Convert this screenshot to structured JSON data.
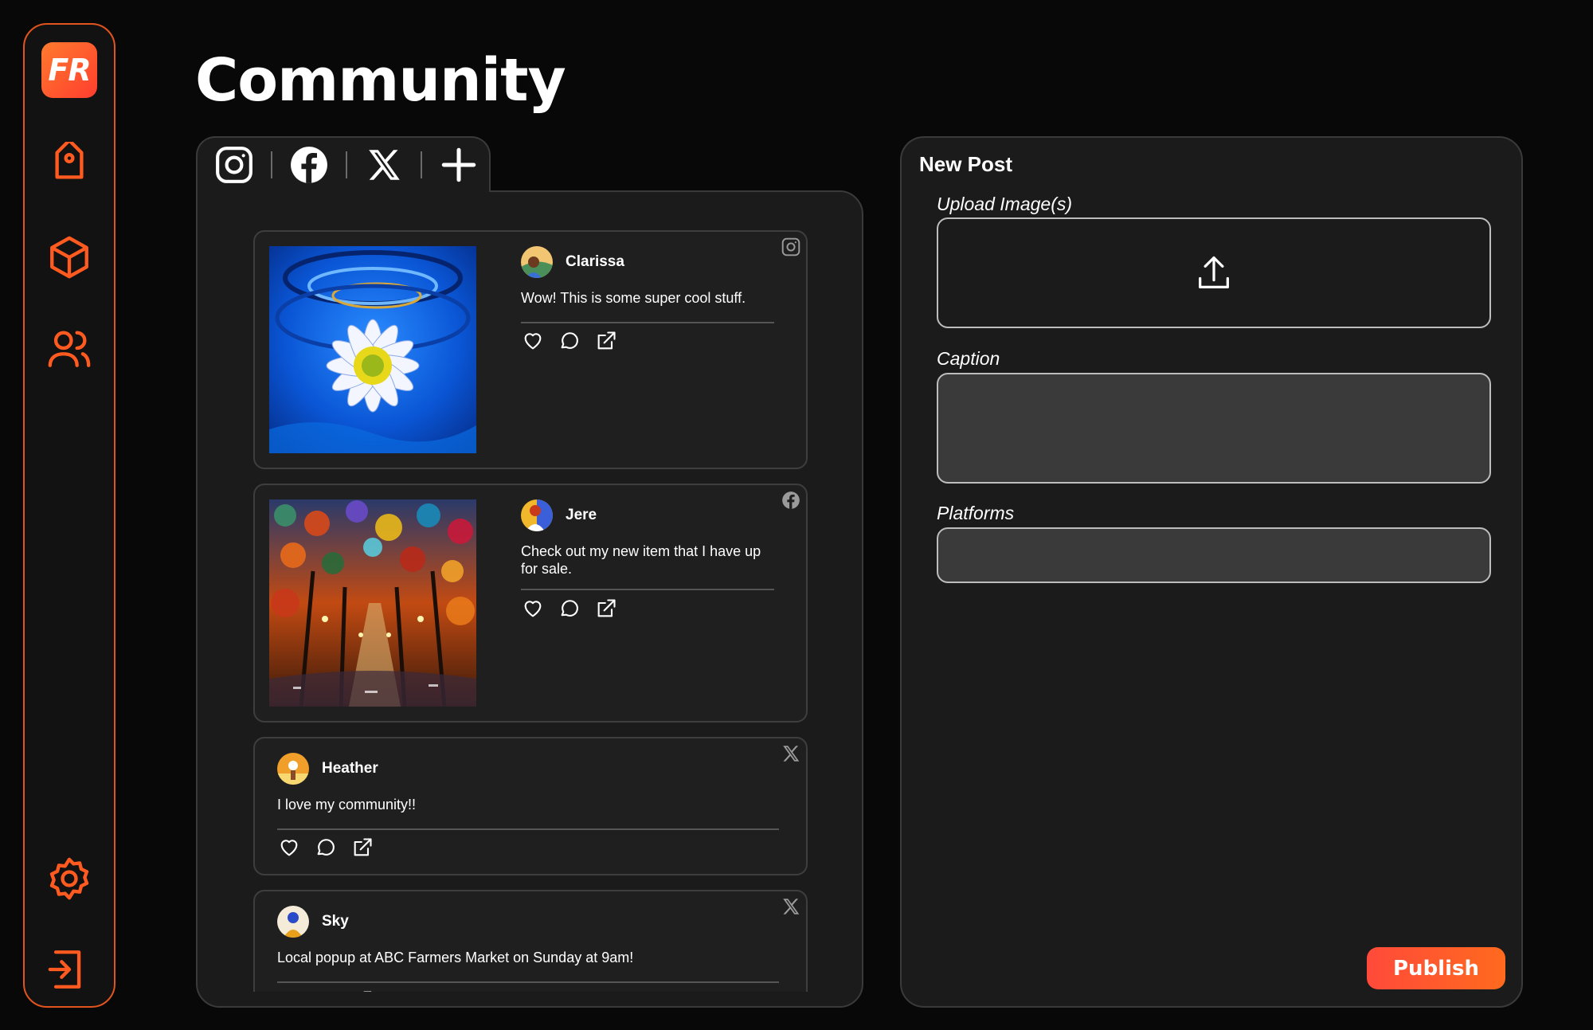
{
  "app": {
    "logo_text": "FR",
    "accent": "#e2541e"
  },
  "sidebar": {
    "items": [
      {
        "name": "tag-icon"
      },
      {
        "name": "box-icon"
      },
      {
        "name": "users-icon"
      },
      {
        "name": "settings-icon"
      },
      {
        "name": "logout-icon"
      }
    ]
  },
  "page": {
    "title": "Community"
  },
  "tabs": [
    {
      "name": "instagram-icon"
    },
    {
      "name": "facebook-icon"
    },
    {
      "name": "x-icon"
    },
    {
      "name": "plus-icon"
    }
  ],
  "posts": [
    {
      "username": "Clarissa",
      "text": "Wow! This is some super cool stuff.",
      "platform": "instagram-icon",
      "image": "daisy-painting"
    },
    {
      "username": "Jere",
      "text": "Check out my new item that I have up for sale.",
      "platform": "facebook-icon",
      "image": "autumn-street-painting"
    },
    {
      "username": "Heather",
      "text": "I love my community!!",
      "platform": "x-icon"
    },
    {
      "username": "Sky",
      "text": "Local popup at ABC Farmers Market on Sunday at 9am!",
      "platform": "x-icon"
    }
  ],
  "new_post": {
    "title": "New Post",
    "upload_label": "Upload Image(s)",
    "caption_label": "Caption",
    "caption_value": "",
    "platforms_label": "Platforms",
    "platforms_value": "",
    "publish_label": "Publish"
  }
}
